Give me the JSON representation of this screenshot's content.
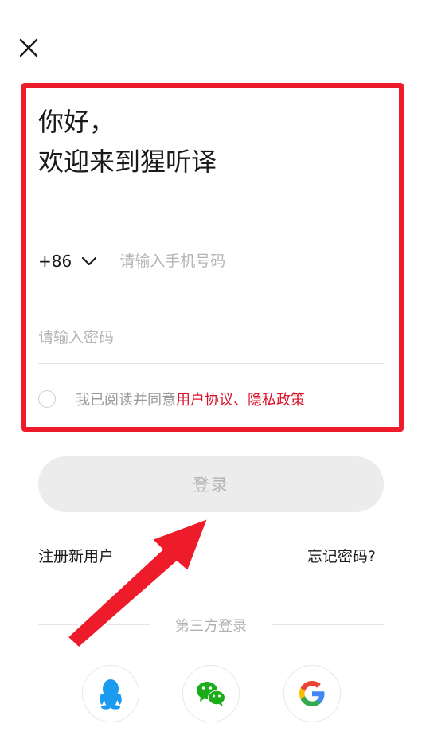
{
  "greeting": {
    "line1": "你好，",
    "line2": "欢迎来到猩听译"
  },
  "phone": {
    "country_code": "+86",
    "placeholder": "请输入手机号码",
    "value": ""
  },
  "password": {
    "placeholder": "请输入密码",
    "value": ""
  },
  "agreement": {
    "checked": false,
    "prefix": "我已阅读并同意",
    "user_agreement": "用户协议",
    "separator": "、",
    "privacy_policy": "隐私政策"
  },
  "login": {
    "label": "登录"
  },
  "links": {
    "register": "注册新用户",
    "forgot_password": "忘记密码?"
  },
  "third_party": {
    "label": "第三方登录",
    "providers": [
      "qq-icon",
      "wechat-icon",
      "google-icon"
    ]
  },
  "colors": {
    "highlight": "#ee1c2a",
    "link_red": "#d9142b",
    "button_disabled_bg": "#ececec",
    "qq_blue": "#1a9bf0",
    "wechat_green": "#1aad19"
  }
}
